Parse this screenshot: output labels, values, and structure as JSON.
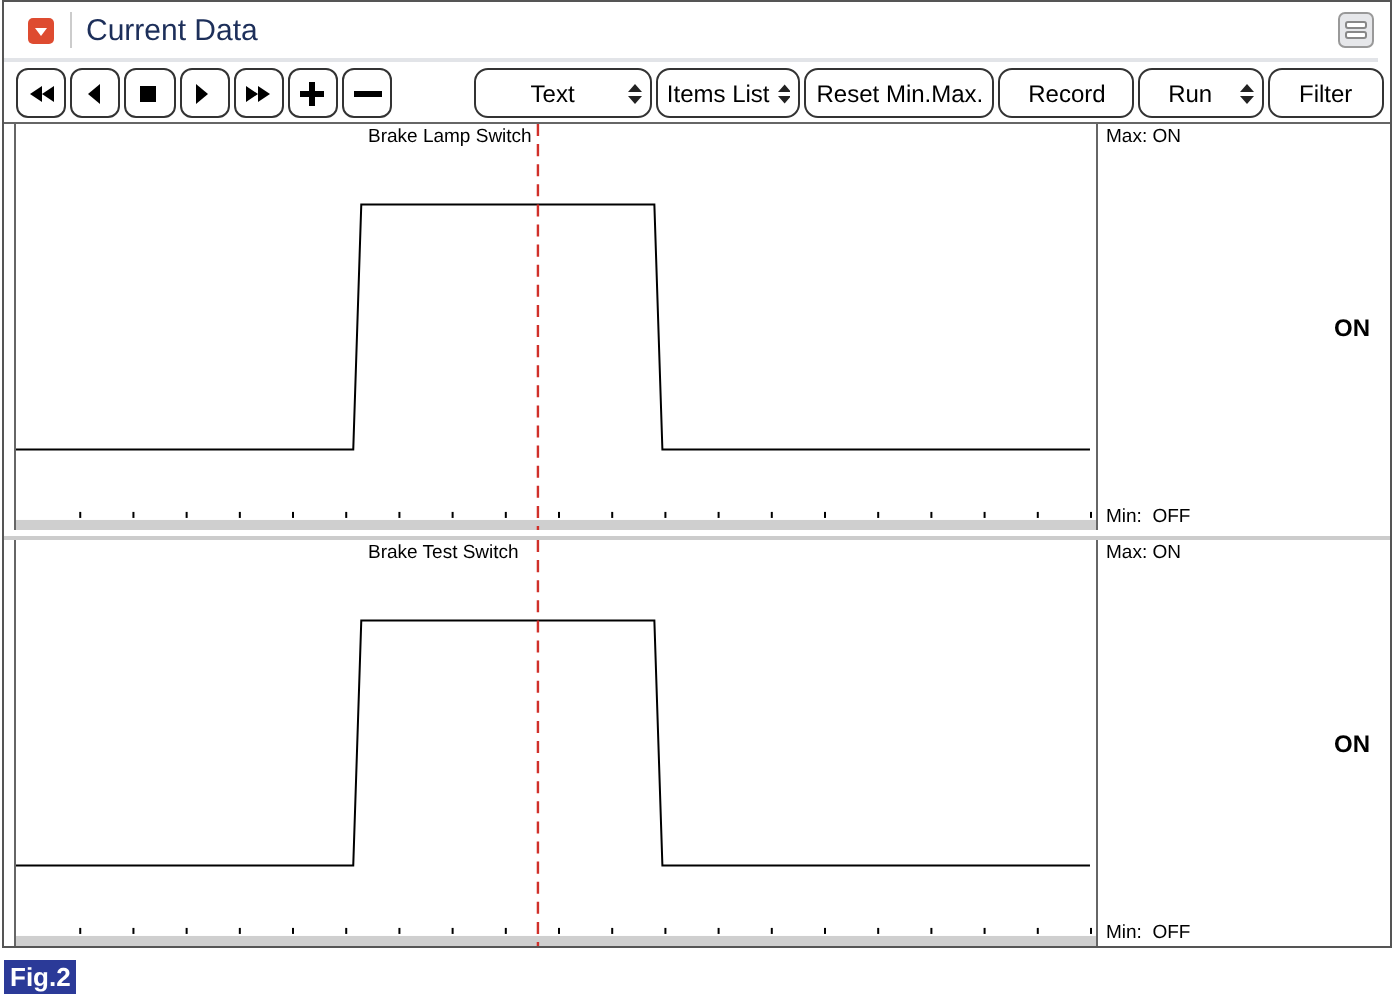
{
  "window": {
    "title": "Current Data"
  },
  "toolbar": {
    "icon_buttons": [
      {
        "kind": "rewind"
      },
      {
        "kind": "back"
      },
      {
        "kind": "stop"
      },
      {
        "kind": "play"
      },
      {
        "kind": "forward"
      },
      {
        "kind": "plus"
      },
      {
        "kind": "minus"
      }
    ],
    "buttons": [
      {
        "label": "Text",
        "kind": "select"
      },
      {
        "label": "Items List",
        "kind": "select"
      },
      {
        "label": "Reset Min.Max.",
        "kind": "plain"
      },
      {
        "label": "Record",
        "kind": "plain"
      },
      {
        "label": "Run",
        "kind": "select"
      },
      {
        "label": "Filter",
        "kind": "plain"
      }
    ]
  },
  "panels": [
    {
      "signal": "Brake Lamp Switch",
      "max": "Max: ON",
      "min": "Min:  OFF",
      "value": "ON"
    },
    {
      "signal": "Brake Test Switch",
      "max": "Max: ON",
      "min": "Min:  OFF",
      "value": "ON"
    }
  ],
  "figure_label": "Fig.2"
}
